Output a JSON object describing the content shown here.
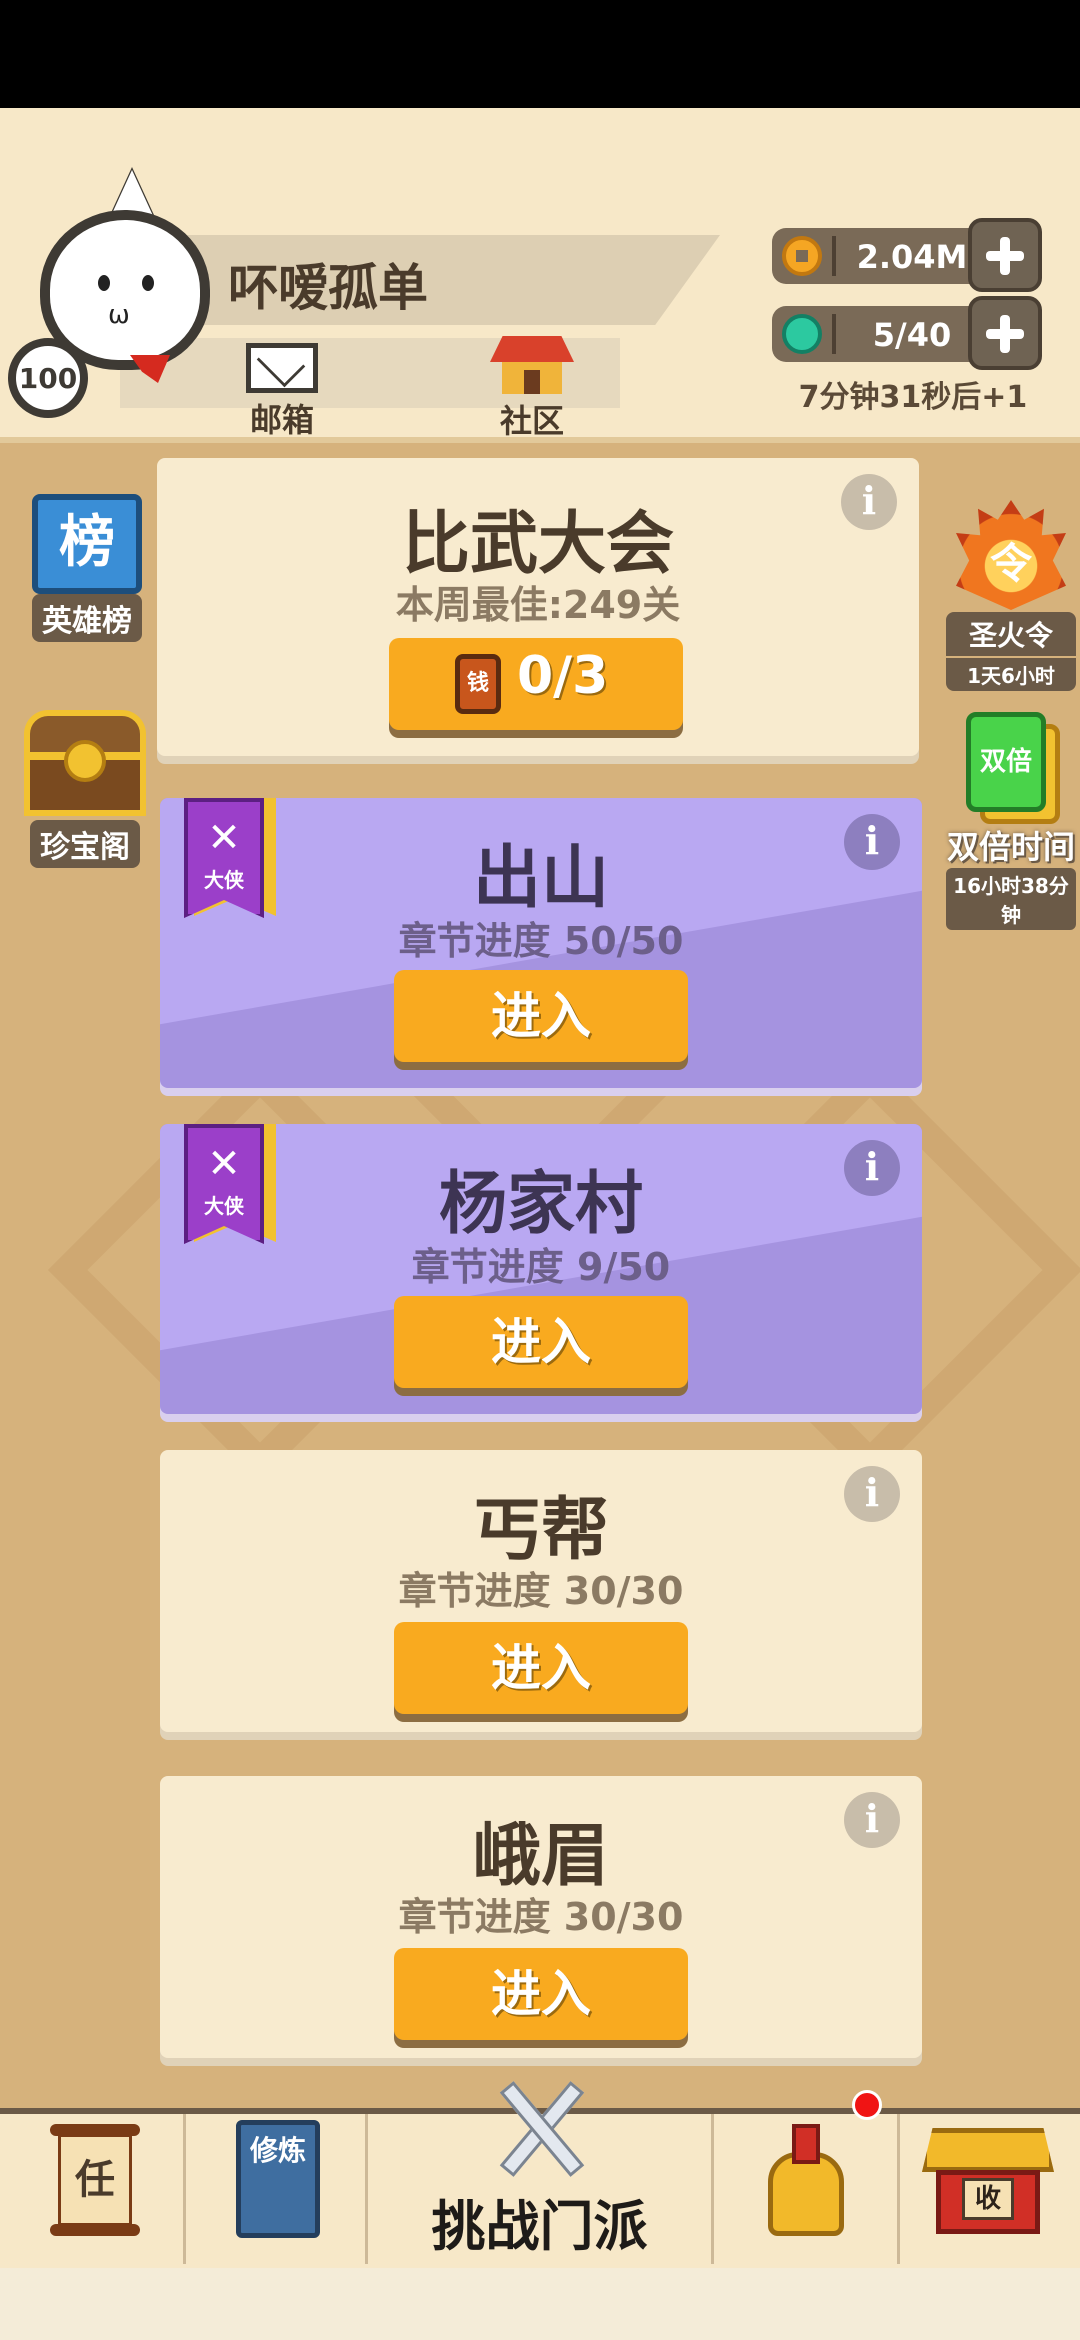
{
  "player": {
    "name": "吥嗳孤单",
    "level": "100"
  },
  "header": {
    "mail_label": "邮箱",
    "community_label": "社区"
  },
  "resources": {
    "coins": "2.04M",
    "stamina": "5/40",
    "stamina_timer": "7分钟31秒后+1"
  },
  "side_left": [
    {
      "label": "英雄榜",
      "icon_char": "榜",
      "icon": "rank-banner-icon"
    },
    {
      "label": "珍宝阁",
      "icon": "treasure-chest-icon"
    }
  ],
  "side_right": [
    {
      "label": "圣火令",
      "icon_char": "令",
      "sub": "1天6小时",
      "icon": "sacred-flame-icon"
    },
    {
      "label": "双倍时间",
      "icon_char": "双倍",
      "sub": "16小时38分钟",
      "icon": "double-card-icon"
    }
  ],
  "cards": [
    {
      "title": "比武大会",
      "subtitle": "本周最佳:249关",
      "button_value": "0/3",
      "ticket_char": "钱",
      "style": "cream"
    },
    {
      "title": "出山",
      "subtitle": "章节进度 50/50",
      "button": "进入",
      "style": "purple",
      "ribbon": "大侠"
    },
    {
      "title": "杨家村",
      "subtitle": "章节进度 9/50",
      "button": "进入",
      "style": "purple",
      "ribbon": "大侠"
    },
    {
      "title": "丐帮",
      "subtitle": "章节进度 30/30",
      "button": "进入",
      "style": "cream"
    },
    {
      "title": "峨眉",
      "subtitle": "章节进度 30/30",
      "button": "进入",
      "style": "cream"
    }
  ],
  "info_glyph": "i",
  "ribbon_swords": "✕",
  "bottom_nav": {
    "task_char": "任",
    "train_chars": "修炼",
    "challenge_label": "挑战门派",
    "collect_char": "收"
  },
  "colors": {
    "accent_orange": "#f9aa1f",
    "card_purple": "#a593e0",
    "card_cream": "#f8ebcf",
    "background": "#d6b27c"
  }
}
